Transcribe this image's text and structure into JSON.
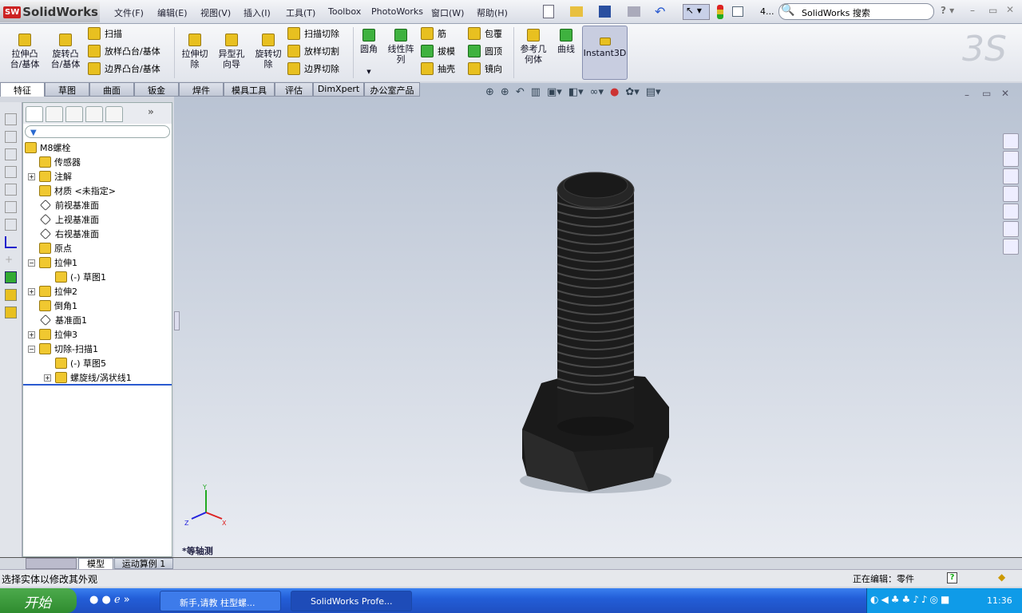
{
  "app": {
    "logo": "SolidWorks",
    "logo_badge": "SW"
  },
  "menu": [
    "文件(F)",
    "编辑(E)",
    "视图(V)",
    "插入(I)",
    "工具(T)",
    "Toolbox",
    "PhotoWorks",
    "窗口(W)",
    "帮助(H)"
  ],
  "toolbar": {
    "search_placeholder": "SolidWorks 搜索",
    "counter": "4..."
  },
  "ribbon": {
    "big": [
      {
        "label": "拉伸凸\n台/基体"
      },
      {
        "label": "旋转凸\n台/基体"
      },
      {
        "label": "拉伸切\n除"
      },
      {
        "label": "异型孔\n向导"
      },
      {
        "label": "旋转切\n除"
      },
      {
        "label": "圆角"
      },
      {
        "label": "线性阵\n列"
      },
      {
        "label": "参考几\n何体"
      },
      {
        "label": "曲线"
      },
      {
        "label": "Instant3D"
      }
    ],
    "small1": [
      "扫描",
      "放样凸台/基体",
      "边界凸台/基体"
    ],
    "small2": [
      "扫描切除",
      "放样切割",
      "边界切除"
    ],
    "small3": [
      "筋",
      "拔模",
      "抽壳"
    ],
    "small4": [
      "包覆",
      "圆顶",
      "镜向"
    ]
  },
  "tabs": [
    "特征",
    "草图",
    "曲面",
    "钣金",
    "焊件",
    "模具工具",
    "评估",
    "DimXpert",
    "办公室产品"
  ],
  "tree": {
    "root": "M8螺栓",
    "items": [
      "传感器",
      "注解",
      "材质 <未指定>",
      "前视基准面",
      "上视基准面",
      "右视基准面",
      "原点",
      "拉伸1",
      "(-) 草图1",
      "拉伸2",
      "倒角1",
      "基准面1",
      "拉伸3",
      "切除-扫描1",
      "(-) 草图5",
      "螺旋线/涡状线1"
    ]
  },
  "viewport": {
    "view_name": "*等轴测",
    "triad": {
      "x": "X",
      "y": "Y",
      "z": "Z"
    }
  },
  "bottom_tabs": [
    "模型",
    "运动算例 1"
  ],
  "status": {
    "message": "选择实体以修改其外观",
    "editing": "正在编辑：零件"
  },
  "taskbar": {
    "start": "开始",
    "items": [
      "新手,请教 柱型螺...",
      "SolidWorks Profe..."
    ],
    "clock": "11:36"
  }
}
